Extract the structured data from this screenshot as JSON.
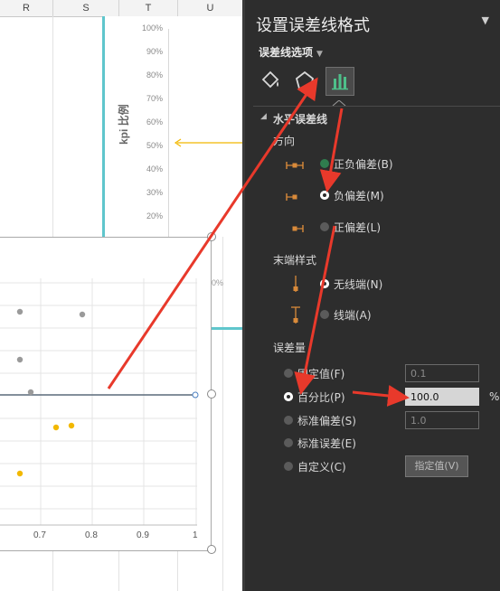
{
  "sheet": {
    "columns": [
      "R",
      "S",
      "T",
      "U"
    ],
    "y_axis_ticks": [
      "100%",
      "90%",
      "80%",
      "70%",
      "60%",
      "50%",
      "40%",
      "30%",
      "20%"
    ],
    "y_axis_title": "kpi 比例",
    "partial_label": "0%",
    "x_axis_ticks": [
      "0.7",
      "0.8",
      "0.9",
      "1"
    ]
  },
  "panel": {
    "title": "设置误差线格式",
    "options_tab": "误差线选项",
    "section_horizontal": "水平误差线",
    "direction": {
      "heading": "方向",
      "options": [
        "正负偏差(B)",
        "负偏差(M)",
        "正偏差(L)"
      ],
      "selected": "负偏差(M)"
    },
    "end_style": {
      "heading": "末端样式",
      "options": [
        "无线端(N)",
        "线端(A)"
      ],
      "selected": "无线端(N)"
    },
    "error_amount": {
      "heading": "误差量",
      "options": [
        "固定值(F)",
        "百分比(P)",
        "标准偏差(S)",
        "标准误差(E)",
        "自定义(C)"
      ],
      "selected": "百分比(P)",
      "fixed_value": "0.1",
      "percent_value": "100.0",
      "percent_unit": "%",
      "std_dev_value": "1.0",
      "custom_button": "指定值(V)"
    }
  },
  "colors": {
    "panel_bg": "#2d2d2d",
    "accent_teal": "#5fc6cc",
    "annotation_red": "#e8392b",
    "point_gray": "#9a9a9a",
    "point_yellow": "#f2b800",
    "icon_orange": "#d98a3a"
  }
}
